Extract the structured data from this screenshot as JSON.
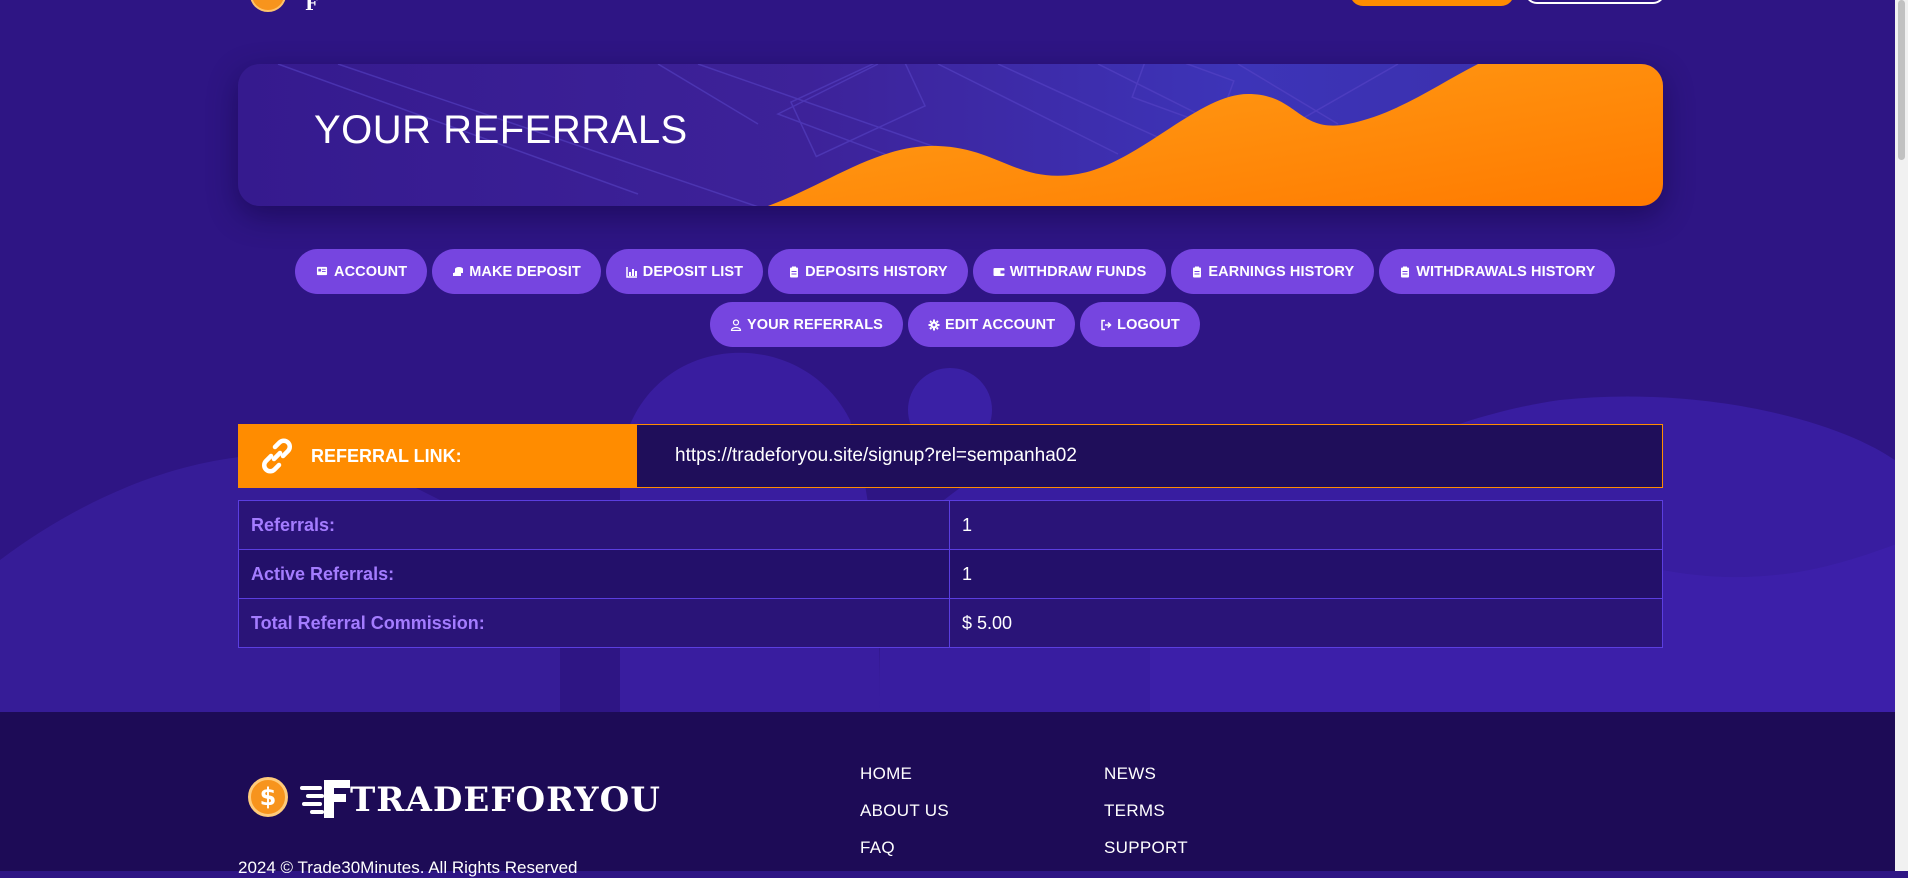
{
  "banner": {
    "title": "YOUR REFERRALS"
  },
  "nav": {
    "row1": [
      {
        "label": "ACCOUNT",
        "icon": "id-card-icon"
      },
      {
        "label": "MAKE DEPOSIT",
        "icon": "coins-icon"
      },
      {
        "label": "DEPOSIT LIST",
        "icon": "bar-chart-icon"
      },
      {
        "label": "DEPOSITS HISTORY",
        "icon": "clipboard-icon"
      },
      {
        "label": "WITHDRAW FUNDS",
        "icon": "wallet-icon"
      },
      {
        "label": "EARNINGS HISTORY",
        "icon": "clipboard-icon"
      },
      {
        "label": "WITHDRAWALS HISTORY",
        "icon": "clipboard-icon"
      }
    ],
    "row2": [
      {
        "label": "YOUR REFERRALS",
        "icon": "user-icon"
      },
      {
        "label": "EDIT ACCOUNT",
        "icon": "gear-icon"
      },
      {
        "label": "LOGOUT",
        "icon": "logout-icon"
      }
    ]
  },
  "referral_link": {
    "label": "REFERRAL LINK:",
    "url": "https://tradeforyou.site/signup?rel=sempanha02"
  },
  "stats": [
    {
      "label": "Referrals:",
      "value": "1"
    },
    {
      "label": "Active Referrals:",
      "value": "1"
    },
    {
      "label": "Total Referral Commission:",
      "value": "$ 5.00"
    }
  ],
  "footer": {
    "brand": "TRADEFORYOU",
    "copyright": "2024 © Trade30Minutes. All Rights Reserved",
    "col1": [
      "HOME",
      "ABOUT US",
      "FAQ"
    ],
    "col2": [
      "NEWS",
      "TERMS",
      "SUPPORT"
    ]
  },
  "colors": {
    "accent": "#ff8c00",
    "background": "#2e1584",
    "button": "#7645e0",
    "label": "#a47cff"
  }
}
